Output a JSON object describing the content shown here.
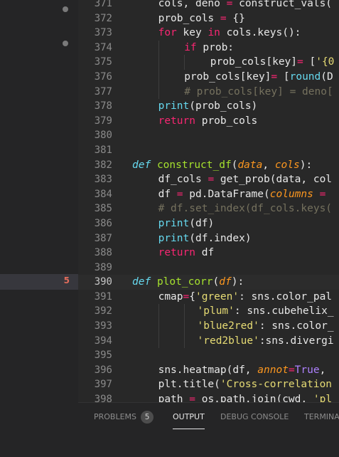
{
  "sidebar": {
    "selected_badge": "5"
  },
  "editor": {
    "lines": [
      {
        "n": "371",
        "indent": 1,
        "tokens": [
          [
            "",
            "cols, deno "
          ],
          [
            "op",
            "="
          ],
          [
            "",
            " construct_vals("
          ]
        ]
      },
      {
        "n": "372",
        "indent": 1,
        "tokens": [
          [
            "",
            "prob_cols "
          ],
          [
            "op",
            "="
          ],
          [
            "",
            " {}"
          ]
        ]
      },
      {
        "n": "373",
        "indent": 1,
        "tokens": [
          [
            "kw",
            "for"
          ],
          [
            "",
            " key "
          ],
          [
            "kw",
            "in"
          ],
          [
            "",
            " cols.keys():"
          ]
        ]
      },
      {
        "n": "374",
        "indent": 2,
        "tokens": [
          [
            "kw",
            "if"
          ],
          [
            "",
            " prob:"
          ]
        ]
      },
      {
        "n": "375",
        "indent": 3,
        "tokens": [
          [
            "",
            "prob_cols[key]"
          ],
          [
            "op",
            "="
          ],
          [
            "",
            " ["
          ],
          [
            "str",
            "'{0"
          ]
        ]
      },
      {
        "n": "376",
        "indent": 2,
        "tokens": [
          [
            "",
            "prob_cols[key]"
          ],
          [
            "op",
            "="
          ],
          [
            "",
            " ["
          ],
          [
            "bi",
            "round"
          ],
          [
            "",
            "(D"
          ]
        ]
      },
      {
        "n": "377",
        "indent": 2,
        "tokens": [
          [
            "cmt",
            "# prob_cols[key] = deno["
          ]
        ]
      },
      {
        "n": "378",
        "indent": 1,
        "tokens": [
          [
            "bi",
            "print"
          ],
          [
            "",
            "(prob_cols)"
          ]
        ]
      },
      {
        "n": "379",
        "indent": 1,
        "tokens": [
          [
            "kw",
            "return"
          ],
          [
            "",
            " prob_cols"
          ]
        ]
      },
      {
        "n": "380",
        "indent": 0,
        "tokens": []
      },
      {
        "n": "381",
        "indent": 0,
        "tokens": []
      },
      {
        "n": "382",
        "indent": 0,
        "tokens": [
          [
            "def",
            "def"
          ],
          [
            "",
            " "
          ],
          [
            "fn",
            "construct_df"
          ],
          [
            "",
            "("
          ],
          [
            "prm",
            "data"
          ],
          [
            "",
            ", "
          ],
          [
            "prm",
            "cols"
          ],
          [
            "",
            "):"
          ]
        ]
      },
      {
        "n": "383",
        "indent": 1,
        "tokens": [
          [
            "",
            "df_cols "
          ],
          [
            "op",
            "="
          ],
          [
            "",
            " get_prob(data, col"
          ]
        ]
      },
      {
        "n": "384",
        "indent": 1,
        "tokens": [
          [
            "",
            "df "
          ],
          [
            "op",
            "="
          ],
          [
            "",
            " pd.DataFrame("
          ],
          [
            "prm",
            "columns"
          ],
          [
            "",
            " "
          ],
          [
            "op",
            "="
          ]
        ]
      },
      {
        "n": "385",
        "indent": 1,
        "tokens": [
          [
            "cmt",
            "# df.set_index(df_cols.keys("
          ]
        ]
      },
      {
        "n": "386",
        "indent": 1,
        "tokens": [
          [
            "bi",
            "print"
          ],
          [
            "",
            "(df)"
          ]
        ]
      },
      {
        "n": "387",
        "indent": 1,
        "tokens": [
          [
            "bi",
            "print"
          ],
          [
            "",
            "(df.index)"
          ]
        ]
      },
      {
        "n": "388",
        "indent": 1,
        "tokens": [
          [
            "kw",
            "return"
          ],
          [
            "",
            " df"
          ]
        ]
      },
      {
        "n": "389",
        "indent": 0,
        "tokens": []
      },
      {
        "n": "390",
        "indent": 0,
        "current": true,
        "tokens": [
          [
            "def",
            "def"
          ],
          [
            "",
            " "
          ],
          [
            "fn",
            "plot_corr"
          ],
          [
            "",
            "("
          ],
          [
            "prm",
            "df"
          ],
          [
            "",
            "):"
          ]
        ]
      },
      {
        "n": "391",
        "indent": 1,
        "tokens": [
          [
            "",
            "cmap"
          ],
          [
            "op",
            "="
          ],
          [
            "",
            "{"
          ],
          [
            "str",
            "'green'"
          ],
          [
            "",
            ": sns.color_pal"
          ]
        ]
      },
      {
        "n": "392",
        "indent": 2,
        "pad": 2,
        "tokens": [
          [
            "str",
            "'plum'"
          ],
          [
            "",
            ": sns.cubehelix_"
          ]
        ]
      },
      {
        "n": "393",
        "indent": 2,
        "pad": 2,
        "tokens": [
          [
            "str",
            "'blue2red'"
          ],
          [
            "",
            ": sns.color_"
          ]
        ]
      },
      {
        "n": "394",
        "indent": 2,
        "pad": 2,
        "tokens": [
          [
            "str",
            "'red2blue'"
          ],
          [
            "",
            ":sns.divergi"
          ]
        ]
      },
      {
        "n": "395",
        "indent": 0,
        "tokens": []
      },
      {
        "n": "396",
        "indent": 1,
        "tokens": [
          [
            "",
            "sns.heatmap(df, "
          ],
          [
            "prm",
            "annot"
          ],
          [
            "op",
            "="
          ],
          [
            "num",
            "True"
          ],
          [
            "",
            ","
          ]
        ]
      },
      {
        "n": "397",
        "indent": 1,
        "tokens": [
          [
            "",
            "plt.title("
          ],
          [
            "str",
            "'Cross-correlation"
          ]
        ]
      },
      {
        "n": "398",
        "indent": 1,
        "tokens": [
          [
            "",
            "path "
          ],
          [
            "op",
            "="
          ],
          [
            "",
            " os.path.join(cwd, "
          ],
          [
            "str",
            "'pl"
          ]
        ]
      }
    ]
  },
  "panel": {
    "tabs": [
      {
        "label": "PROBLEMS",
        "badge": "5"
      },
      {
        "label": "OUTPUT",
        "active": true
      },
      {
        "label": "DEBUG CONSOLE"
      },
      {
        "label": "TERMINA"
      }
    ]
  }
}
